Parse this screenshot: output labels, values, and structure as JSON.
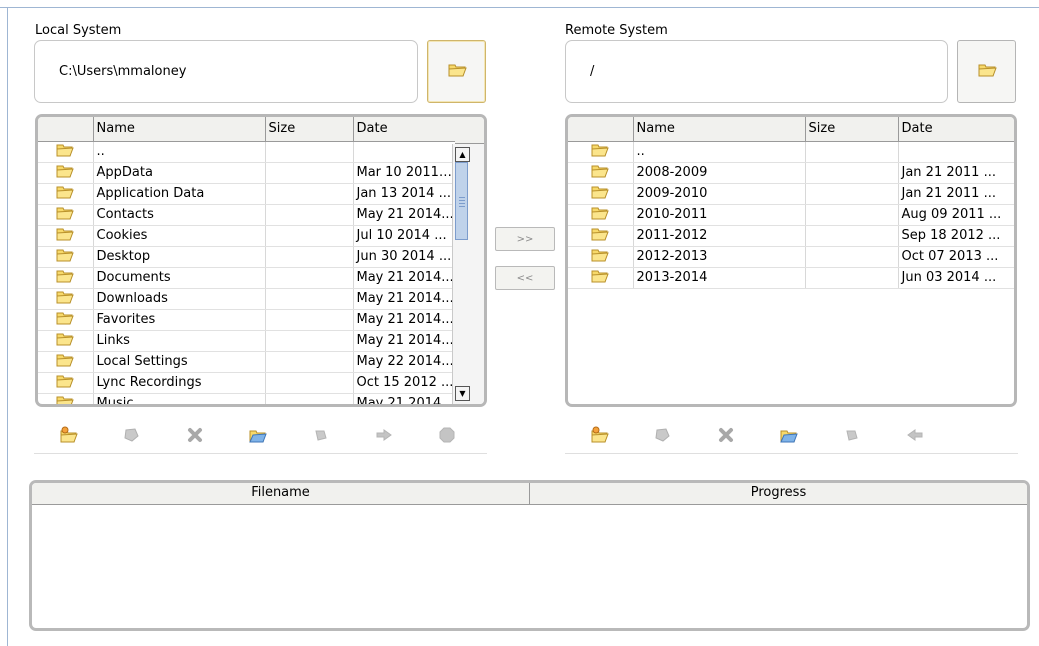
{
  "local": {
    "label": "Local System",
    "path": "C:\\Users\\mmaloney",
    "columns": [
      "Name",
      "Size",
      "Date"
    ],
    "rows": [
      {
        "name": "..",
        "size": "",
        "date": ""
      },
      {
        "name": "AppData",
        "size": "",
        "date": "Mar 10 2011 ..."
      },
      {
        "name": "Application Data",
        "size": "",
        "date": "Jan 13 2014 ..."
      },
      {
        "name": "Contacts",
        "size": "",
        "date": "May 21 2014..."
      },
      {
        "name": "Cookies",
        "size": "",
        "date": "Jul 10 2014 ..."
      },
      {
        "name": "Desktop",
        "size": "",
        "date": "Jun 30 2014 ..."
      },
      {
        "name": "Documents",
        "size": "",
        "date": "May 21 2014..."
      },
      {
        "name": "Downloads",
        "size": "",
        "date": "May 21 2014..."
      },
      {
        "name": "Favorites",
        "size": "",
        "date": "May 21 2014..."
      },
      {
        "name": "Links",
        "size": "",
        "date": "May 21 2014..."
      },
      {
        "name": "Local Settings",
        "size": "",
        "date": "May 22 2014..."
      },
      {
        "name": "Lync Recordings",
        "size": "",
        "date": "Oct 15 2012 ..."
      },
      {
        "name": "Music",
        "size": "",
        "date": "May 21 2014..."
      }
    ],
    "toolbar_icons": [
      "new-folder-icon",
      "rename-icon",
      "delete-icon",
      "refresh-folder-icon",
      "properties-icon",
      "upload-arrow-icon",
      "stop-icon"
    ]
  },
  "remote": {
    "label": "Remote System",
    "path": "/",
    "columns": [
      "Name",
      "Size",
      "Date"
    ],
    "rows": [
      {
        "name": "..",
        "size": "",
        "date": ""
      },
      {
        "name": "2008-2009",
        "size": "",
        "date": "Jan 21 2011 ..."
      },
      {
        "name": "2009-2010",
        "size": "",
        "date": "Jan 21 2011 ..."
      },
      {
        "name": "2010-2011",
        "size": "",
        "date": "Aug 09 2011 ..."
      },
      {
        "name": "2011-2012",
        "size": "",
        "date": "Sep 18 2012 ..."
      },
      {
        "name": "2012-2013",
        "size": "",
        "date": "Oct 07 2013 ..."
      },
      {
        "name": "2013-2014",
        "size": "",
        "date": "Jun 03 2014 ..."
      }
    ],
    "toolbar_icons": [
      "new-folder-icon",
      "rename-icon",
      "delete-icon",
      "refresh-folder-icon",
      "properties-icon",
      "download-arrow-icon"
    ]
  },
  "transfer": {
    "upload_label": ">>",
    "download_label": "<<"
  },
  "progress_table": {
    "columns": [
      "Filename",
      "Progress"
    ]
  },
  "colors": {
    "folder_fill": "#f7d96a",
    "folder_stroke": "#b8902a",
    "frame_border": "#b7b7b7",
    "scroll_thumb": "#bfd2ea",
    "accent_frame": "#9fb6d3"
  }
}
